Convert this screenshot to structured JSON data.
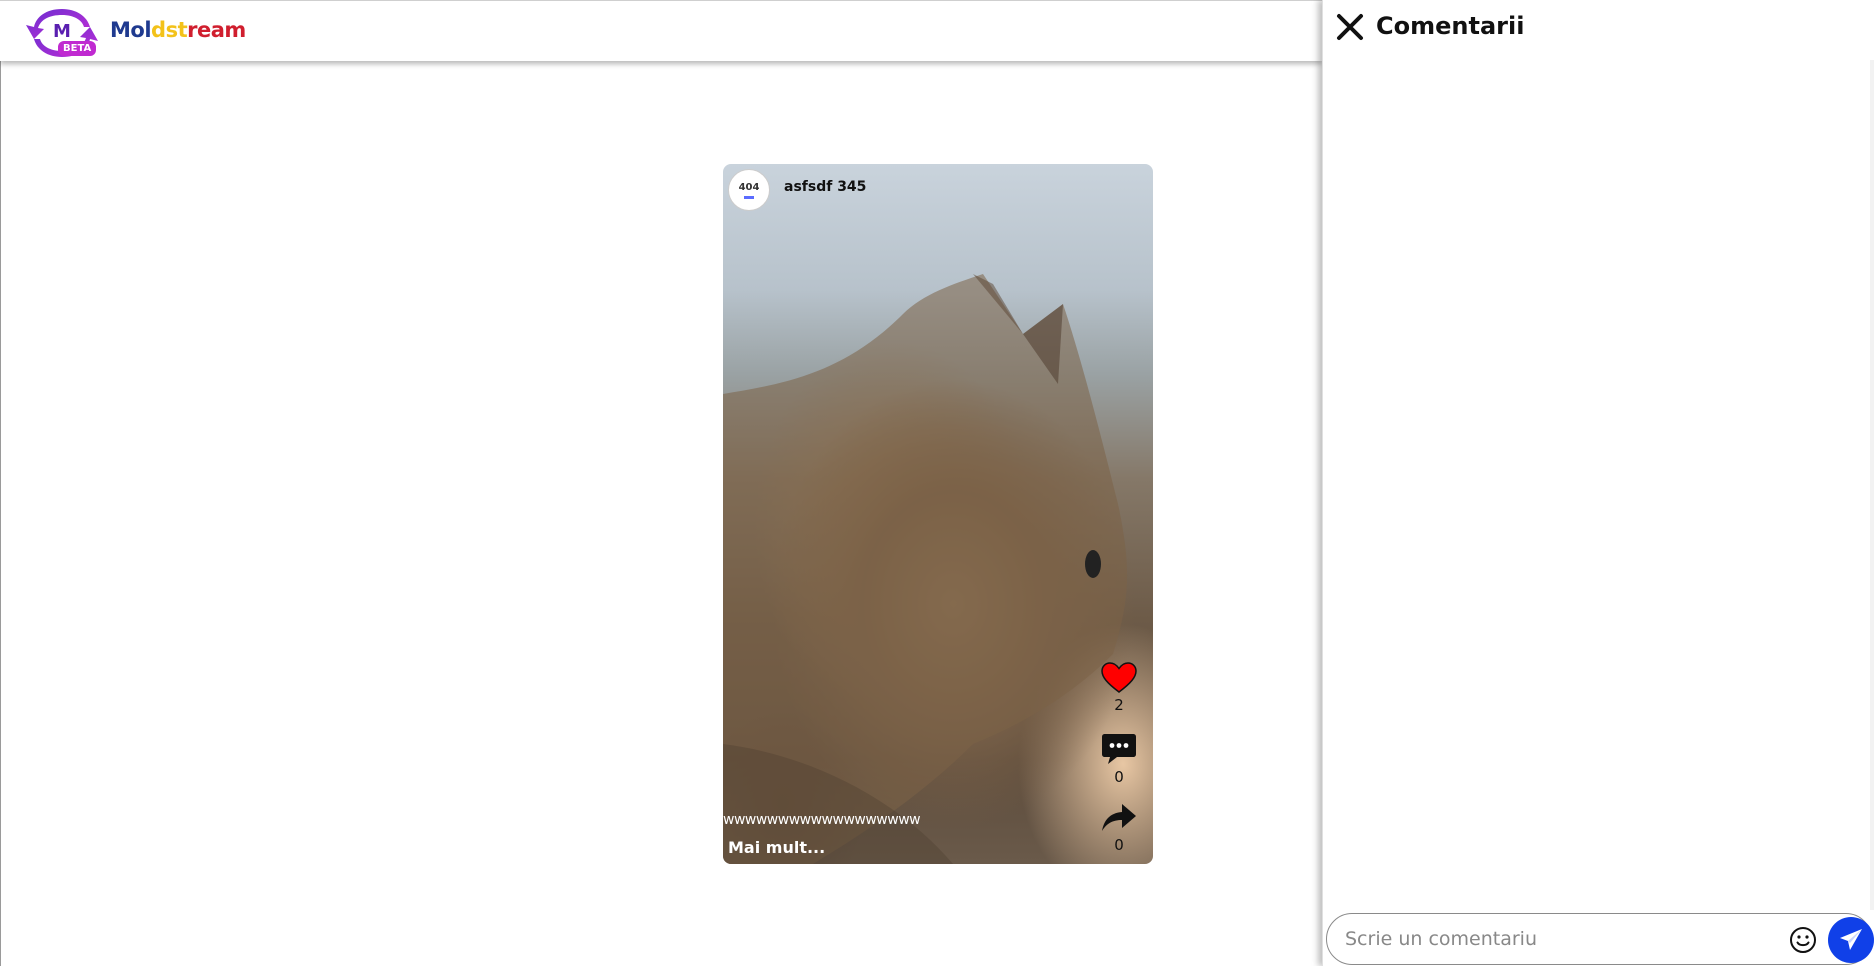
{
  "app": {
    "logo_letter": "M",
    "beta_label": "BETA",
    "brand_parts": [
      "Mol",
      "dst",
      "ream"
    ],
    "brand_colors": [
      "#1f3a8f",
      "#f3c21a",
      "#d01e2e"
    ]
  },
  "video": {
    "author_avatar_text": "404",
    "author_name": "asfsdf 345",
    "likes": "2",
    "comments": "0",
    "shares": "0",
    "caption": "wwwwwwwwwwwwwwwwww",
    "more_label": "Mai mult...",
    "like_color": "#ff0000",
    "icons": [
      "heart-icon",
      "comment-bubble-icon",
      "share-arrow-icon"
    ]
  },
  "comments_panel": {
    "title": "Comentarii",
    "close_icon": "close-icon",
    "input_placeholder": "Scrie un comentariu",
    "emoji_icon": "smiley-icon",
    "send_icon": "paper-plane-icon",
    "send_color": "#1040e8"
  }
}
